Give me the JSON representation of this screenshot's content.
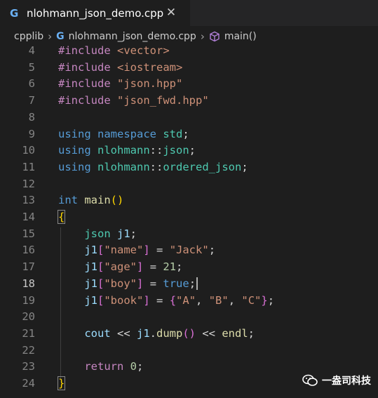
{
  "tab": {
    "title": "nlohmann_json_demo.cpp",
    "icon": "cpp-file-icon",
    "close_glyph": "✕",
    "icon_glyph": "G"
  },
  "breadcrumb": {
    "folder": "cpplib",
    "file": "nlohmann_json_demo.cpp",
    "symbol": "main()",
    "sep": "›"
  },
  "lines": [
    {
      "n": "4",
      "parts": [
        [
          "kw-inc",
          "#include "
        ],
        [
          "str",
          "<vector>"
        ]
      ]
    },
    {
      "n": "5",
      "parts": [
        [
          "kw-inc",
          "#include "
        ],
        [
          "str",
          "<iostream>"
        ]
      ]
    },
    {
      "n": "6",
      "parts": [
        [
          "kw-inc",
          "#include "
        ],
        [
          "str",
          "\"json.hpp\""
        ]
      ]
    },
    {
      "n": "7",
      "parts": [
        [
          "kw-inc",
          "#include "
        ],
        [
          "str",
          "\"json_fwd.hpp\""
        ]
      ]
    },
    {
      "n": "8",
      "parts": []
    },
    {
      "n": "9",
      "parts": [
        [
          "kw",
          "using "
        ],
        [
          "kw",
          "namespace "
        ],
        [
          "ns",
          "std"
        ],
        [
          "plain",
          ";"
        ]
      ]
    },
    {
      "n": "10",
      "parts": [
        [
          "kw",
          "using "
        ],
        [
          "ns",
          "nlohmann"
        ],
        [
          "plain",
          "::"
        ],
        [
          "ns",
          "json"
        ],
        [
          "plain",
          ";"
        ]
      ]
    },
    {
      "n": "11",
      "parts": [
        [
          "kw",
          "using "
        ],
        [
          "ns",
          "nlohmann"
        ],
        [
          "plain",
          "::"
        ],
        [
          "ns",
          "ordered_json"
        ],
        [
          "plain",
          ";"
        ]
      ]
    },
    {
      "n": "12",
      "parts": []
    },
    {
      "n": "13",
      "parts": [
        [
          "kw",
          "int "
        ],
        [
          "fn",
          "main"
        ],
        [
          "br1",
          "()"
        ]
      ]
    },
    {
      "n": "14",
      "parts": [
        [
          "br1",
          "{"
        ]
      ]
    },
    {
      "n": "15",
      "parts": [
        [
          "plain",
          "    "
        ],
        [
          "ns",
          "json "
        ],
        [
          "var",
          "j1"
        ],
        [
          "plain",
          ";"
        ]
      ]
    },
    {
      "n": "16",
      "parts": [
        [
          "plain",
          "    "
        ],
        [
          "var",
          "j1"
        ],
        [
          "br2",
          "["
        ],
        [
          "str",
          "\"name\""
        ],
        [
          "br2",
          "]"
        ],
        [
          "plain",
          " = "
        ],
        [
          "str",
          "\"Jack\""
        ],
        [
          "plain",
          ";"
        ]
      ]
    },
    {
      "n": "17",
      "parts": [
        [
          "plain",
          "    "
        ],
        [
          "var",
          "j1"
        ],
        [
          "br2",
          "["
        ],
        [
          "str",
          "\"age\""
        ],
        [
          "br2",
          "]"
        ],
        [
          "plain",
          " = "
        ],
        [
          "num",
          "21"
        ],
        [
          "plain",
          ";"
        ]
      ]
    },
    {
      "n": "18",
      "parts": [
        [
          "plain",
          "    "
        ],
        [
          "var",
          "j1"
        ],
        [
          "br2",
          "["
        ],
        [
          "str",
          "\"boy\""
        ],
        [
          "br2",
          "]"
        ],
        [
          "plain",
          " = "
        ],
        [
          "kw",
          "true"
        ],
        [
          "plain",
          ";"
        ]
      ]
    },
    {
      "n": "19",
      "parts": [
        [
          "plain",
          "    "
        ],
        [
          "var",
          "j1"
        ],
        [
          "br2",
          "["
        ],
        [
          "str",
          "\"book\""
        ],
        [
          "br2",
          "]"
        ],
        [
          "plain",
          " = "
        ],
        [
          "br2",
          "{"
        ],
        [
          "str",
          "\"A\""
        ],
        [
          "plain",
          ", "
        ],
        [
          "str",
          "\"B\""
        ],
        [
          "plain",
          ", "
        ],
        [
          "str",
          "\"C\""
        ],
        [
          "br2",
          "}"
        ],
        [
          "plain",
          ";"
        ]
      ]
    },
    {
      "n": "20",
      "parts": []
    },
    {
      "n": "21",
      "parts": [
        [
          "plain",
          "    "
        ],
        [
          "var",
          "cout"
        ],
        [
          "plain",
          " << "
        ],
        [
          "var",
          "j1"
        ],
        [
          "plain",
          "."
        ],
        [
          "fn",
          "dump"
        ],
        [
          "br2",
          "()"
        ],
        [
          "plain",
          " << "
        ],
        [
          "fn",
          "endl"
        ],
        [
          "plain",
          ";"
        ]
      ]
    },
    {
      "n": "22",
      "parts": []
    },
    {
      "n": "23",
      "parts": [
        [
          "plain",
          "    "
        ],
        [
          "kw-inc",
          "return "
        ],
        [
          "num",
          "0"
        ],
        [
          "plain",
          ";"
        ]
      ]
    },
    {
      "n": "24",
      "parts": [
        [
          "br1",
          "}"
        ]
      ]
    }
  ],
  "active_line": "18",
  "watermark": {
    "text": "一盎司科技",
    "icon": "wechat-icon"
  }
}
